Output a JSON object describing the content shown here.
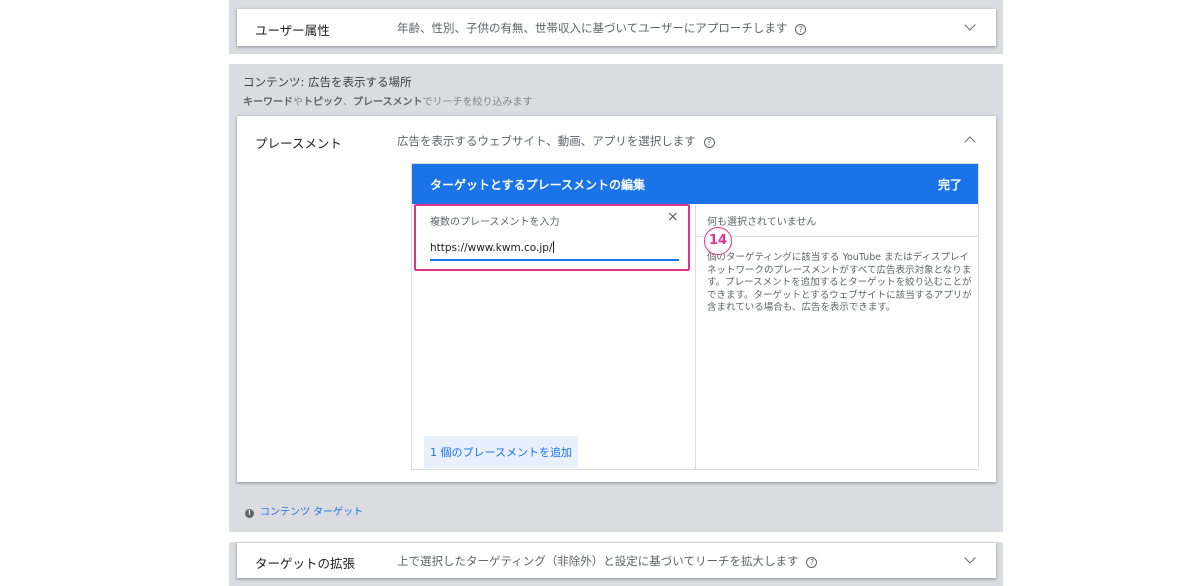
{
  "demographics": {
    "title": "ユーザー属性",
    "description": "年齢、性別、子供の有無、世帯収入に基づいてユーザーにアプローチします"
  },
  "content_section": {
    "title": "コンテンツ: 広告を表示する場所",
    "sub_kw": "キーワード",
    "sub_ya": "や",
    "sub_topic": "トピック",
    "sub_sep": "、",
    "sub_placement": "プレースメント",
    "sub_rest": "でリーチを絞り込みます"
  },
  "placement": {
    "title": "プレースメント",
    "description": "広告を表示するウェブサイト、動画、アプリを選択します",
    "editor": {
      "title": "ターゲットとするプレースメントの編集",
      "done_label": "完了",
      "input_label": "複数のプレースメントを入力",
      "clear_icon": "×",
      "input_value": "https://www.kwm.co.jp/",
      "add_button": "1 個のプレースメントを追加",
      "selected_status": "何も選択されていません",
      "info_text": "個のターゲティングに該当する YouTube またはディスプレイ ネットワークのプレースメントがすべて広告表示対象となります。プレースメントを追加するとターゲットを絞り込むことができます。ターゲットとするウェブサイトに該当するアプリが含まれている場合も、広告を表示できます。"
    }
  },
  "annotation": {
    "step_label": "14"
  },
  "content_target_link": "コンテンツ ターゲット",
  "expansion": {
    "title": "ターゲットの拡張",
    "description": "上で選択したターゲティング（非除外）と設定に基づいてリーチを拡大します"
  },
  "icons": {
    "help": "help-circle-icon",
    "chevron": "chevron-icon",
    "info": "info-icon",
    "clear": "close-icon"
  },
  "colors": {
    "accent": "#1a73e8",
    "highlight": "#e0338a",
    "panel_bg": "#dadce0"
  }
}
